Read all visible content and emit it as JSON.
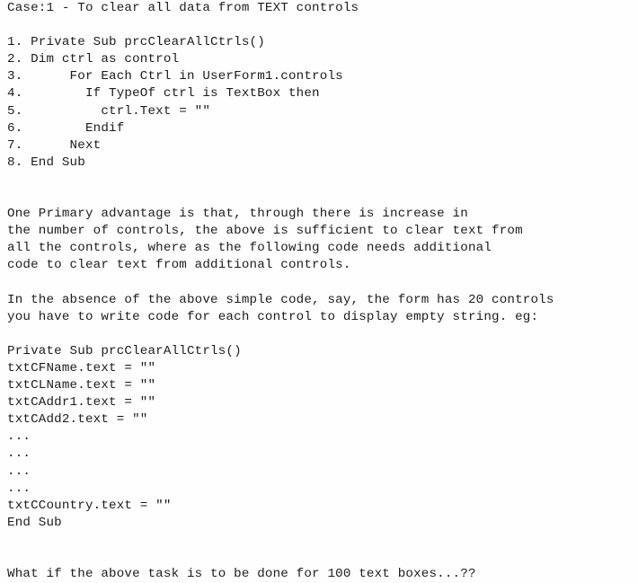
{
  "document": {
    "heading": "Case:1 - To clear all data from TEXT controls",
    "code_block_1": {
      "lines": [
        "1. Private Sub prcClearAllCtrls()",
        "2. Dim ctrl as control",
        "3.      For Each Ctrl in UserForm1.controls",
        "4.        If TypeOf ctrl is TextBox then",
        "5.          ctrl.Text = \"\"",
        "6.        Endif",
        "7.      Next",
        "8. End Sub"
      ]
    },
    "paragraph_1": {
      "lines": [
        "One Primary advantage is that, through there is increase in",
        "the number of controls, the above is sufficient to clear text from",
        "all the controls, where as the following code needs additional",
        "code to clear text from additional controls."
      ]
    },
    "paragraph_2": {
      "lines": [
        "In the absence of the above simple code, say, the form has 20 controls",
        "you have to write code for each control to display empty string. eg:"
      ]
    },
    "code_block_2": {
      "lines": [
        "Private Sub prcClearAllCtrls()",
        "txtCFName.text = \"\"",
        "txtCLName.text = \"\"",
        "txtCAddr1.text = \"\"",
        "txtCAdd2.text = \"\"",
        "...",
        "...",
        "...",
        "...",
        "txtCCountry.text = \"\"",
        "End Sub"
      ]
    },
    "closing_question": "What if the above task is to be done for 100 text boxes...??",
    "blank": " ",
    "colors": {
      "text": "#1d1d1d",
      "background": "#fefefe"
    }
  }
}
